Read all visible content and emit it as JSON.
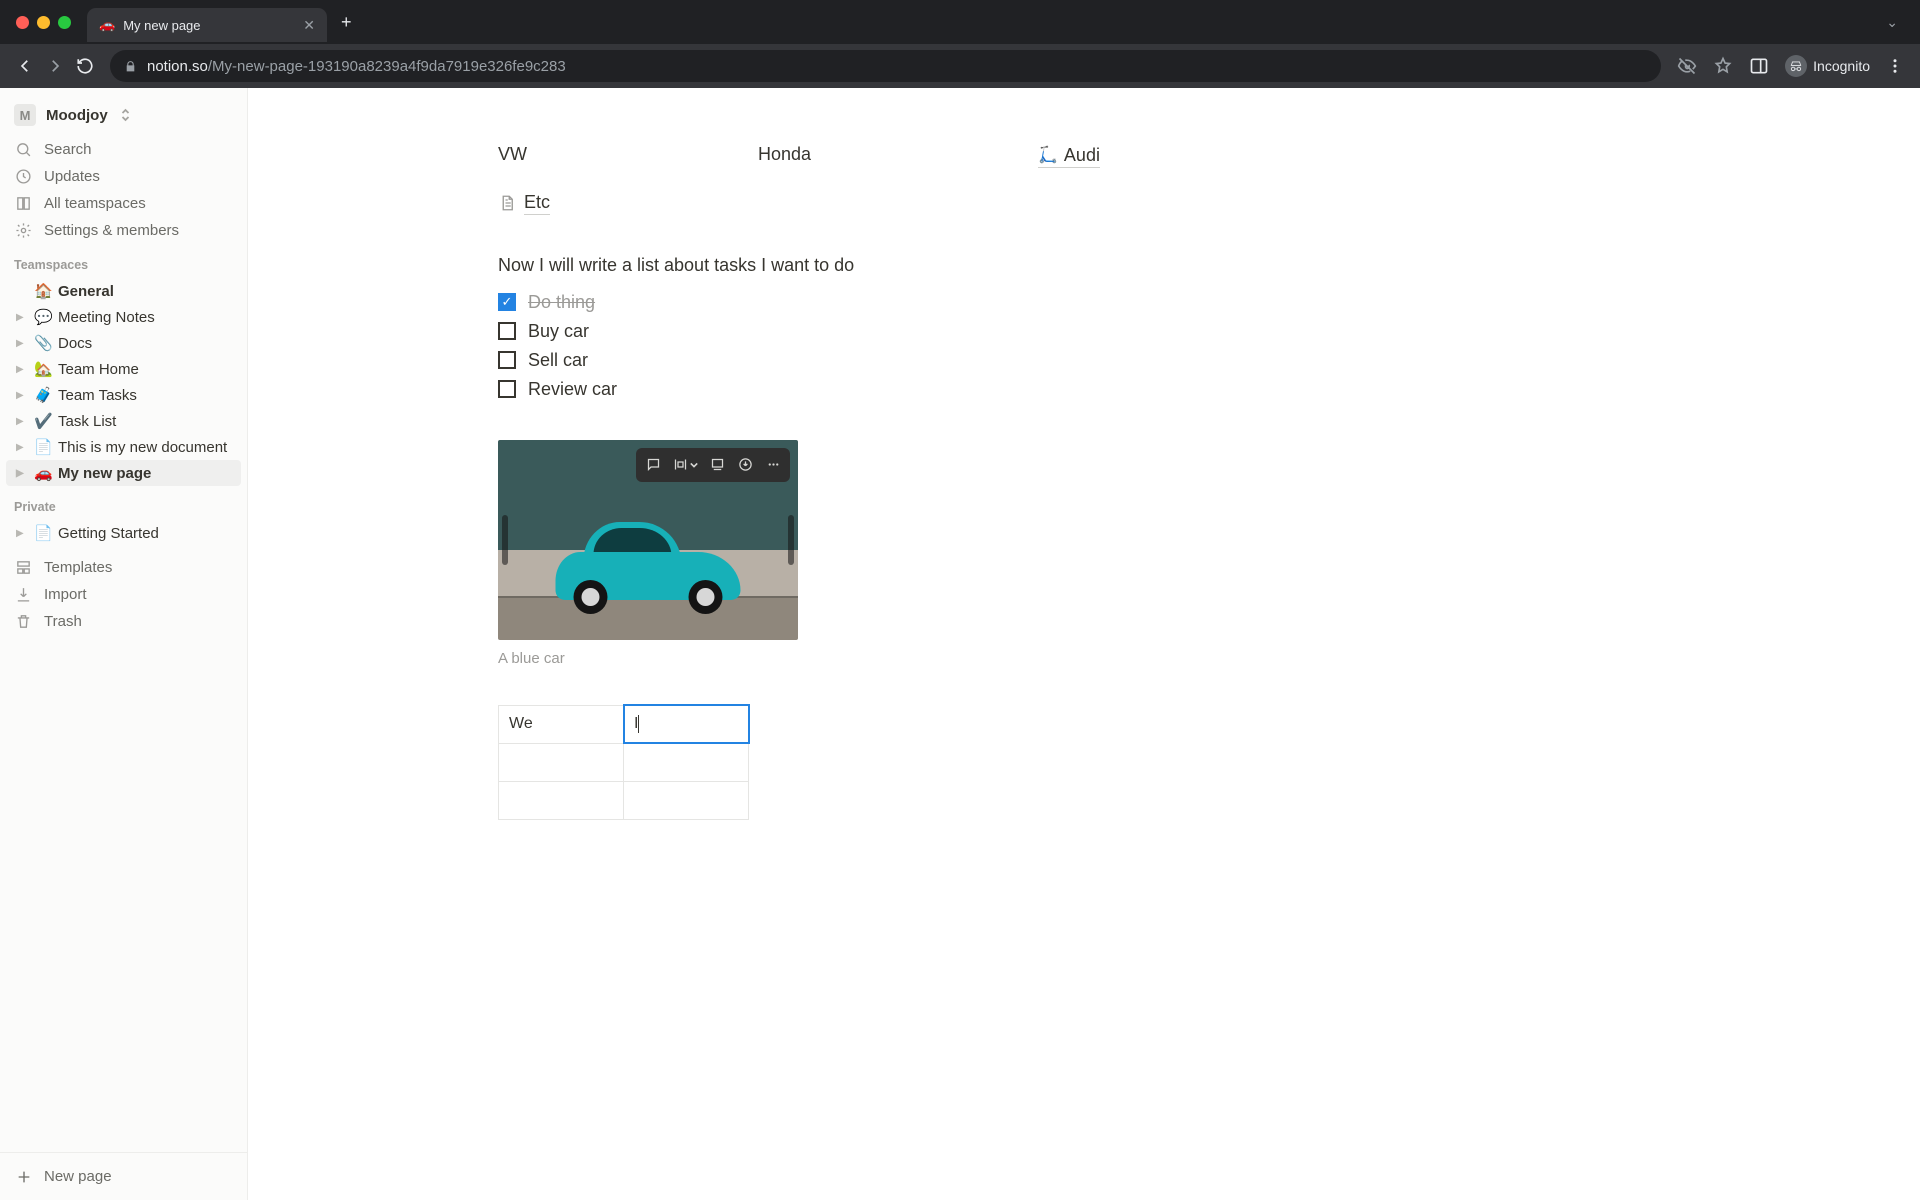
{
  "browser": {
    "tab_favicon": "🚗",
    "tab_title": "My new page",
    "url_domain": "notion.so",
    "url_path": "/My-new-page-193190a8239a4f9da7919e326fe9c283",
    "incognito_label": "Incognito"
  },
  "workspace": {
    "avatar_letter": "M",
    "name": "Moodjoy"
  },
  "sidebar_top": [
    {
      "icon": "search",
      "label": "Search"
    },
    {
      "icon": "clock",
      "label": "Updates"
    },
    {
      "icon": "teamspaces",
      "label": "All teamspaces"
    },
    {
      "icon": "gear",
      "label": "Settings & members"
    }
  ],
  "teamspaces_label": "Teamspaces",
  "teamspaces_items": [
    {
      "icon": "🏠",
      "label": "General",
      "bold": true,
      "toggle": false
    },
    {
      "icon": "💬",
      "label": "Meeting Notes"
    },
    {
      "icon": "📎",
      "label": "Docs"
    },
    {
      "icon": "🏡",
      "label": "Team Home"
    },
    {
      "icon": "🧳",
      "label": "Team Tasks"
    },
    {
      "icon": "✔️",
      "label": "Task List"
    },
    {
      "icon": "📄",
      "label": "This is my new document"
    },
    {
      "icon": "🚗",
      "label": "My new page",
      "active": true
    }
  ],
  "private_label": "Private",
  "private_items": [
    {
      "icon": "📄",
      "label": "Getting Started"
    }
  ],
  "sidebar_bottom": [
    {
      "icon": "templates",
      "label": "Templates"
    },
    {
      "icon": "import",
      "label": "Import"
    },
    {
      "icon": "trash",
      "label": "Trash"
    }
  ],
  "new_page_label": "New page",
  "doc": {
    "columns": [
      {
        "label": "VW"
      },
      {
        "label": "Honda"
      },
      {
        "icon": "🛴",
        "label": "Audi",
        "linked": true
      }
    ],
    "subpage": {
      "icon": "page",
      "label": "Etc"
    },
    "intro": "Now I will write a list about tasks I want to do",
    "todos": [
      {
        "checked": true,
        "label": "Do thing"
      },
      {
        "checked": false,
        "label": "Buy car"
      },
      {
        "checked": false,
        "label": "Sell car"
      },
      {
        "checked": false,
        "label": "Review car"
      }
    ],
    "image_caption": "A blue car",
    "table": {
      "rows": [
        [
          "We",
          "I"
        ],
        [
          "",
          ""
        ],
        [
          "",
          ""
        ]
      ],
      "editing_cell": {
        "row": 0,
        "col": 1
      }
    }
  }
}
